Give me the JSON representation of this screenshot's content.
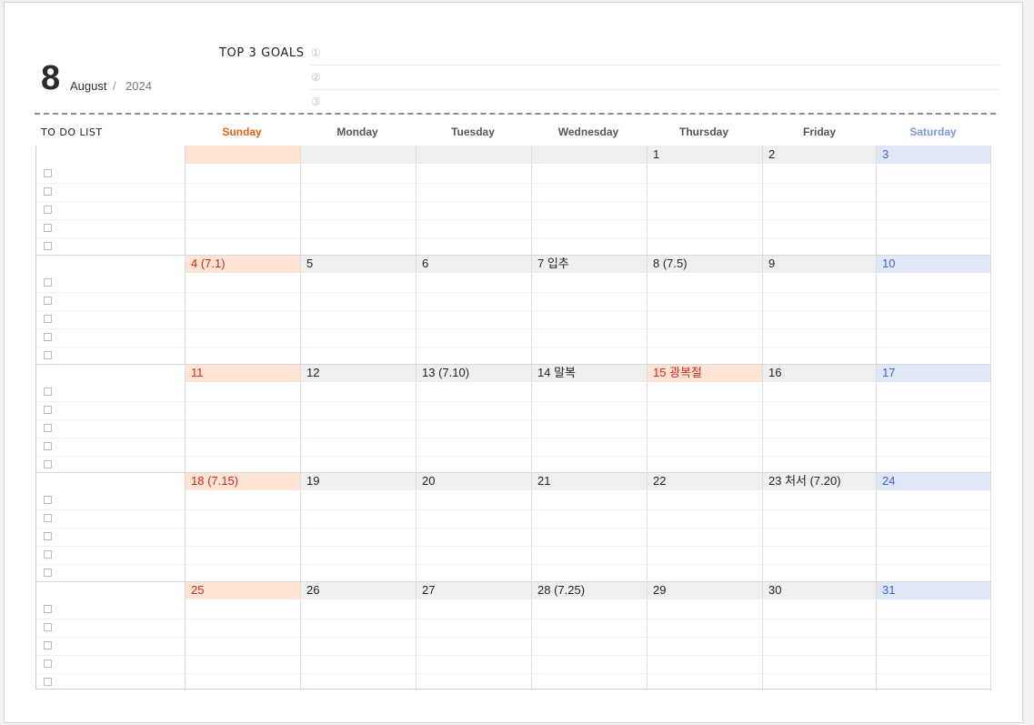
{
  "header": {
    "month_number": "8",
    "month_name": "August",
    "separator": "/",
    "year": "2024"
  },
  "goals": {
    "title": "TOP 3 GOALS",
    "items": [
      {
        "marker": "①",
        "text": ""
      },
      {
        "marker": "②",
        "text": ""
      },
      {
        "marker": "③",
        "text": ""
      }
    ]
  },
  "todo_title": "TO DO LIST",
  "days": [
    "Sunday",
    "Monday",
    "Tuesday",
    "Wednesday",
    "Thursday",
    "Friday",
    "Saturday"
  ],
  "colors": {
    "sunday": "#e06412",
    "saturday": "#7b98d6",
    "holiday_red": "#d7261b",
    "saturday_blue": "#3f66c8",
    "sunday_bg": "#fde4d5",
    "saturday_bg": "#e0e7f7",
    "weekday_bg": "#efefef"
  },
  "weeks": [
    [
      "",
      "",
      "",
      "",
      "1",
      "2",
      "3"
    ],
    [
      "4  (7.1)",
      "5",
      "6",
      "7  입추",
      "8  (7.5)",
      "9",
      "10"
    ],
    [
      "11",
      "12",
      "13  (7.10)",
      "14  말복",
      "15  광복절",
      "16",
      "17"
    ],
    [
      "18  (7.15)",
      "19",
      "20",
      "21",
      "22",
      "23  처서  (7.20)",
      "24"
    ],
    [
      "25",
      "26",
      "27",
      "28  (7.25)",
      "29",
      "30",
      "31"
    ]
  ],
  "holidays": [
    [
      2,
      4
    ]
  ]
}
